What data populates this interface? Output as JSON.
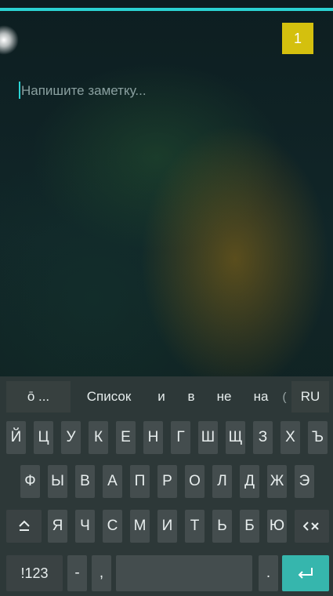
{
  "badge": {
    "count": "1"
  },
  "note": {
    "placeholder": "Напишите заметку..."
  },
  "suggestions": {
    "clipboard_label": "ō ...",
    "items": [
      "Список",
      "и",
      "в",
      "не",
      "на"
    ],
    "cut_off": "(",
    "language": "RU"
  },
  "keyboard": {
    "row1": [
      "Й",
      "Ц",
      "У",
      "К",
      "Е",
      "Н",
      "Г",
      "Ш",
      "Щ",
      "З",
      "Х",
      "Ъ"
    ],
    "row2": [
      "Ф",
      "Ы",
      "В",
      "А",
      "П",
      "Р",
      "О",
      "Л",
      "Д",
      "Ж",
      "Э"
    ],
    "row3": [
      "Я",
      "Ч",
      "С",
      "М",
      "И",
      "Т",
      "Ь",
      "Б",
      "Ю"
    ],
    "shift_icon": "shift-icon",
    "backspace_icon": "backspace-icon",
    "numbers_label": "!123",
    "dash_label": "-",
    "comma_label": ",",
    "period_label": ".",
    "enter_icon": "enter-icon",
    "enter_color": "#36b6ad"
  },
  "colors": {
    "accent": "#2bd3d3",
    "badge": "#d4c00e"
  }
}
